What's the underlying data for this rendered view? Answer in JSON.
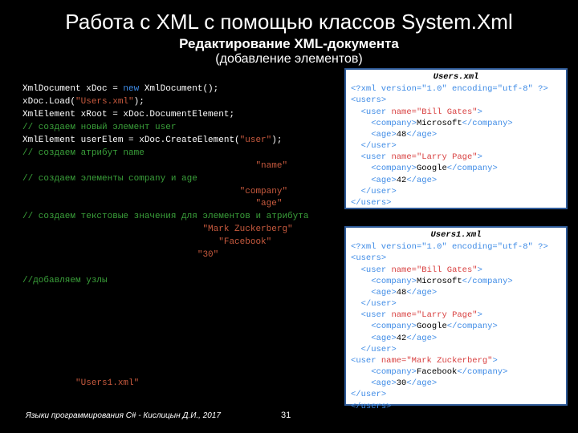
{
  "title": "Работа с XML с помощью классов System.Xml",
  "subtitle": "Редактирование XML-документа",
  "subtitle2": "(добавление элементов)",
  "code": {
    "l1a": "XmlDocument xDoc = ",
    "l1b": "new",
    "l1c": " XmlDocument();",
    "l2a": "xDoc.Load(",
    "l2b": "\"Users.xml\"",
    "l2c": ");",
    "l3": "XmlElement xRoot = xDoc.DocumentElement;",
    "l4": "// создаем новый элемент user",
    "l5a": "XmlElement userElem = xDoc.CreateElement(",
    "l5b": "\"user\"",
    "l5c": ");",
    "l6": "// создаем атрибут name",
    "l7s": "\"name\"",
    "l8": "// создаем элементы company и age",
    "l9s": "\"company\"",
    "l10s": "\"age\"",
    "l11": "// создаем текстовые значения для элементов и атрибута",
    "l12s": "\"Mark Zuckerberg\"",
    "l13s": "\"Facebook\"",
    "l14s": "\"30\"",
    "l15": "//добавляем узлы",
    "l25s": "\"Users1.xml\""
  },
  "box1": {
    "file": "Users.xml",
    "decl": "<?xml version=\"1.0\" encoding=\"utf-8\" ?>",
    "u1name": "Bill Gates",
    "u1comp": "Microsoft",
    "u1age": "48",
    "u2name": "Larry Page",
    "u2comp": "Google",
    "u2age": "42"
  },
  "box2": {
    "file": "Users1.xml",
    "decl": "<?xml version=\"1.0\" encoding=\"utf-8\" ?>",
    "u1name": "Bill Gates",
    "u1comp": "Microsoft",
    "u1age": "48",
    "u2name": "Larry Page",
    "u2comp": "Google",
    "u2age": "42",
    "u3name": "Mark Zuckerberg",
    "u3comp": "Facebook",
    "u3age": "30"
  },
  "footer": "Языки программирования C# - Кислицын Д.И., 2017",
  "page": "31"
}
